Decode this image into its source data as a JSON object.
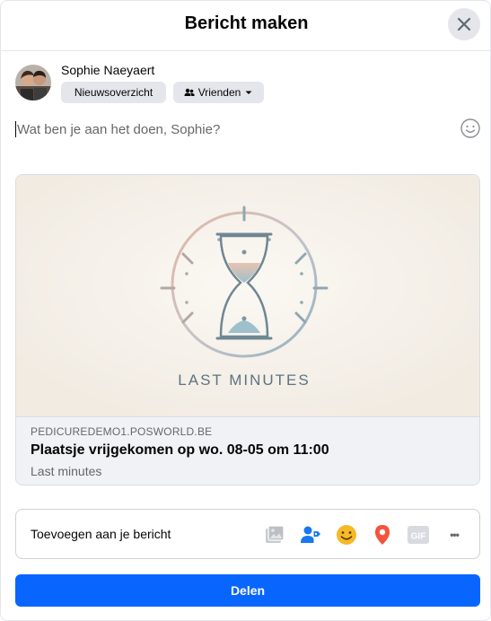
{
  "header": {
    "title": "Bericht maken"
  },
  "user": {
    "name": "Sophie Naeyaert",
    "audience_label": "Nieuwsoverzicht",
    "privacy_label": "Vrienden"
  },
  "composer": {
    "placeholder": "Wat ben je aan het doen, Sophie?"
  },
  "link_preview": {
    "image_caption": "LAST MINUTES",
    "domain": "PEDICUREDEMO1.POSWORLD.BE",
    "title": "Plaatsje vrijgekomen op wo. 08-05 om 11:00",
    "description": "Last minutes"
  },
  "add_to_post": {
    "label": "Toevoegen aan je bericht",
    "icons": [
      "photo-video-icon",
      "tag-people-icon",
      "feeling-icon",
      "check-in-icon",
      "gif-icon",
      "more-icon"
    ],
    "gif_text": "GIF",
    "more_text": "•••"
  },
  "share_button": {
    "label": "Delen"
  },
  "colors": {
    "primary": "#0866ff",
    "feeling": "#f7b928",
    "location": "#f5533d",
    "tag": "#1877f2",
    "disabled": "#bcc0c4"
  }
}
